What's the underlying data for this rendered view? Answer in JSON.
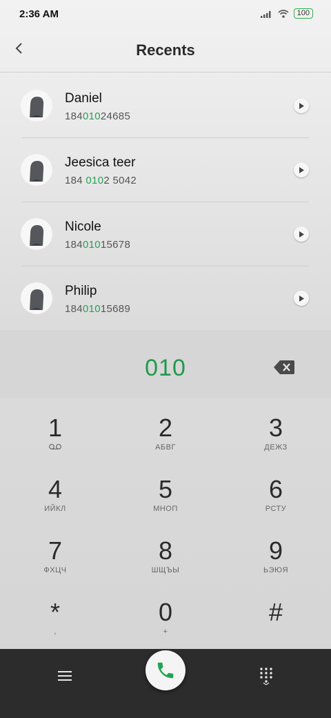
{
  "status": {
    "time": "2:36 AM",
    "battery": "100"
  },
  "header": {
    "title": "Recents"
  },
  "recents": [
    {
      "name": "Daniel",
      "number_pre": "184",
      "number_hl": "010",
      "number_post": "24685"
    },
    {
      "name": "Jeesica teer",
      "number_pre": "184 ",
      "number_hl": "010",
      "number_post": "2 5042"
    },
    {
      "name": "Nicole",
      "number_pre": "184",
      "number_hl": "010",
      "number_post": "15678"
    },
    {
      "name": "Philip",
      "number_pre": "184",
      "number_hl": "010",
      "number_post": "15689"
    }
  ],
  "dialed": "010",
  "keys": [
    {
      "digit": "1",
      "letters": ""
    },
    {
      "digit": "2",
      "letters": "АБВГ"
    },
    {
      "digit": "3",
      "letters": "ДЕЖЗ"
    },
    {
      "digit": "4",
      "letters": "ИЙКЛ"
    },
    {
      "digit": "5",
      "letters": "МНОП"
    },
    {
      "digit": "6",
      "letters": "РСТУ"
    },
    {
      "digit": "7",
      "letters": "ФХЦЧ"
    },
    {
      "digit": "8",
      "letters": "ШЩЪЫ"
    },
    {
      "digit": "9",
      "letters": "ЬЭЮЯ"
    },
    {
      "digit": "*",
      "letters": ","
    },
    {
      "digit": "0",
      "letters": "+"
    },
    {
      "digit": "#",
      "letters": ""
    }
  ],
  "colors": {
    "accent": "#22a352",
    "bottom_bar": "#2c2c2c"
  },
  "icons": {
    "back": "chevron-left-icon",
    "info": "play-arrow-icon",
    "backspace": "backspace-icon",
    "call": "phone-icon",
    "menu": "menu-icon",
    "keypad": "dialpad-icon",
    "voicemail": "voicemail-icon"
  }
}
